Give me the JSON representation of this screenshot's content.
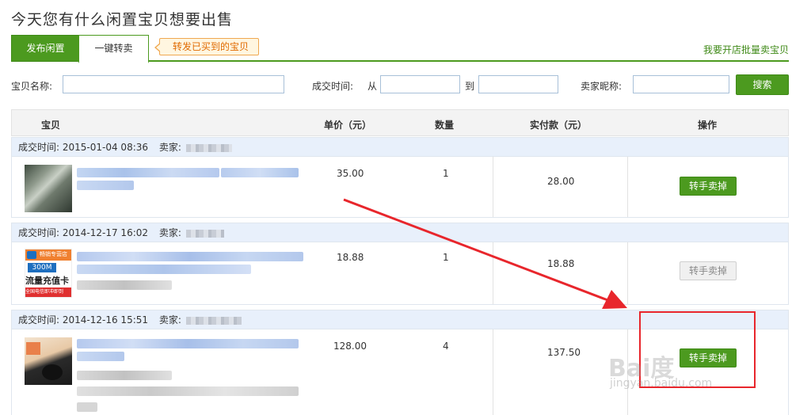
{
  "page": {
    "title": "今天您有什么闲置宝贝想要出售"
  },
  "tabs": {
    "publish": "发布闲置",
    "resell": "一键转卖",
    "tip": "转发已买到的宝贝",
    "batch_link": "我要开店批量卖宝贝"
  },
  "filter": {
    "name_label": "宝贝名称:",
    "time_label": "成交时间:",
    "from_label": "从",
    "to_label": "到",
    "seller_label": "卖家昵称:",
    "search_button": "搜索"
  },
  "table": {
    "headers": {
      "item": "宝贝",
      "price": "单价（元）",
      "qty": "数量",
      "paid": "实付款（元）",
      "action": "操作"
    },
    "orders": [
      {
        "time_label": "成交时间:",
        "time": "2015-01-04 08:36",
        "seller_label": "卖家:",
        "price": "35.00",
        "qty": "1",
        "paid": "28.00",
        "action": "转手卖掉",
        "action_enabled": true
      },
      {
        "time_label": "成交时间:",
        "time": "2014-12-17 16:02",
        "seller_label": "卖家:",
        "price": "18.88",
        "qty": "1",
        "paid": "18.88",
        "action": "转手卖掉",
        "action_enabled": false
      },
      {
        "time_label": "成交时间:",
        "time": "2014-12-16 15:51",
        "seller_label": "卖家:",
        "price": "128.00",
        "qty": "4",
        "paid": "137.50",
        "action": "转手卖掉",
        "action_enabled": true
      }
    ]
  },
  "thumb2": {
    "badge": "畅销专营店",
    "speed": "300M",
    "card": "流量充值卡",
    "foot": "全国电信即冲即到"
  },
  "watermark": {
    "main": "Bai度",
    "sub": "jingyan.baidu.com"
  },
  "colors": {
    "brand_green": "#4c9a1f",
    "tip_orange": "#e06a00",
    "row_header_blue": "#e8f0fb",
    "annotation_red": "#e8262c"
  }
}
